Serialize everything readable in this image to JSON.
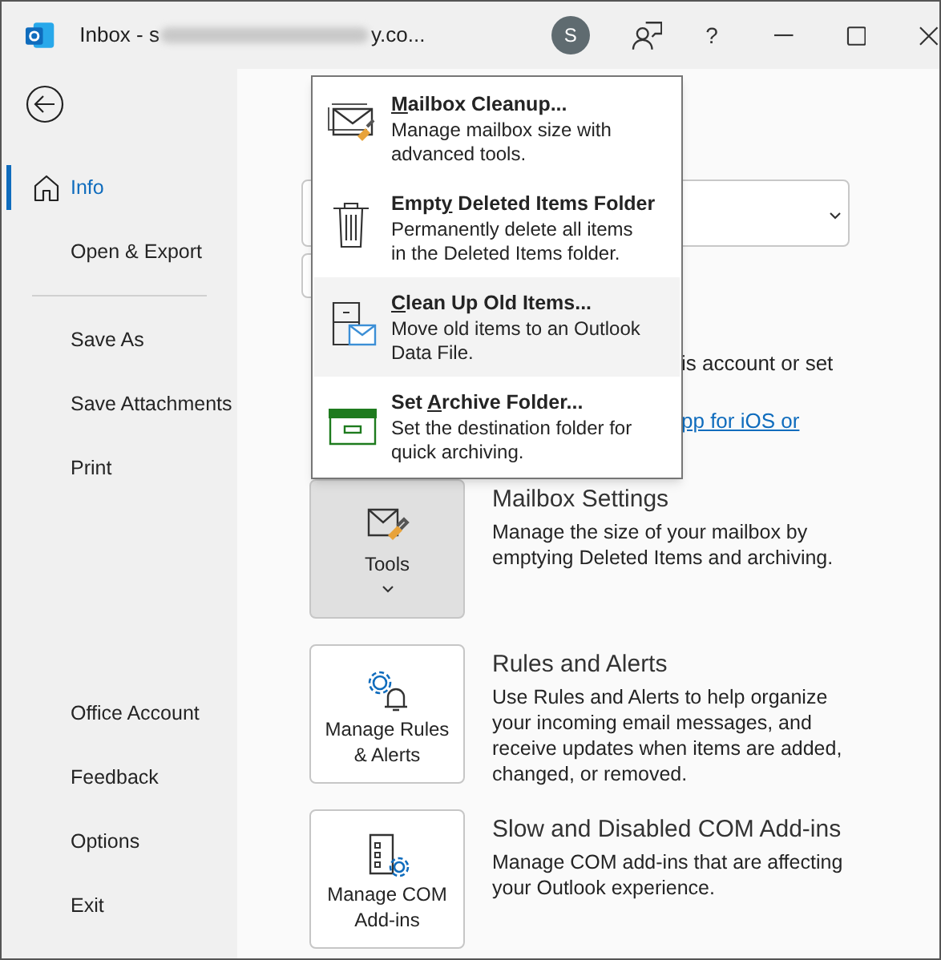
{
  "window": {
    "title_start": "Inbox - s",
    "title_end": "y.co...",
    "avatar": "S",
    "help": "?"
  },
  "sidebar": {
    "top_items": [
      {
        "label": "Info",
        "selected": true
      },
      {
        "label": "Open & Export",
        "selected": false
      }
    ],
    "middle_items": [
      {
        "label": "Save As",
        "selected": false
      },
      {
        "label": "Save Attachments",
        "selected": false
      },
      {
        "label": "Print",
        "selected": false
      }
    ],
    "bottom_items": [
      {
        "label": "Office Account",
        "selected": false
      },
      {
        "label": "Feedback",
        "selected": false
      },
      {
        "label": "Options",
        "selected": false
      },
      {
        "label": "Exit",
        "selected": false
      }
    ]
  },
  "background_fragments": {
    "text": "is account or set",
    "link": "pp for iOS or"
  },
  "tools_menu": {
    "items": [
      {
        "kind": "cleanup",
        "title": {
          "key": "M",
          "post": "ailbox Cleanup..."
        },
        "description": "Manage mailbox size with advanced tools.",
        "selected": false
      },
      {
        "kind": "trash",
        "title": {
          "pre": "Empt",
          "key": "y",
          "post": " Deleted Items Folder"
        },
        "description": "Permanently delete all items in the Deleted Items folder.",
        "selected": false
      },
      {
        "kind": "archive-old",
        "title": {
          "key": "C",
          "post": "lean Up Old Items..."
        },
        "description": "Move old items to an Outlook Data File.",
        "selected": true
      },
      {
        "kind": "archive-folder",
        "title": {
          "pre": "Set ",
          "key": "A",
          "post": "rchive Folder..."
        },
        "description": "Set the destination folder for quick archiving.",
        "selected": false
      }
    ]
  },
  "sections": [
    {
      "kind": "tools",
      "button": "Tools",
      "pressed": true,
      "title": "Mailbox Settings",
      "description": "Manage the size of your mailbox by emptying Deleted Items and archiving."
    },
    {
      "kind": "rules",
      "button": "Manage Rules & Alerts",
      "pressed": false,
      "title": "Rules and Alerts",
      "description": "Use Rules and Alerts to help organize your incoming email messages, and receive updates when items are added, changed, or removed."
    },
    {
      "kind": "com",
      "button": "Manage COM Add-ins",
      "pressed": false,
      "title": "Slow and Disabled COM Add-ins",
      "description": "Manage COM add-ins that are affecting your Outlook experience."
    }
  ]
}
